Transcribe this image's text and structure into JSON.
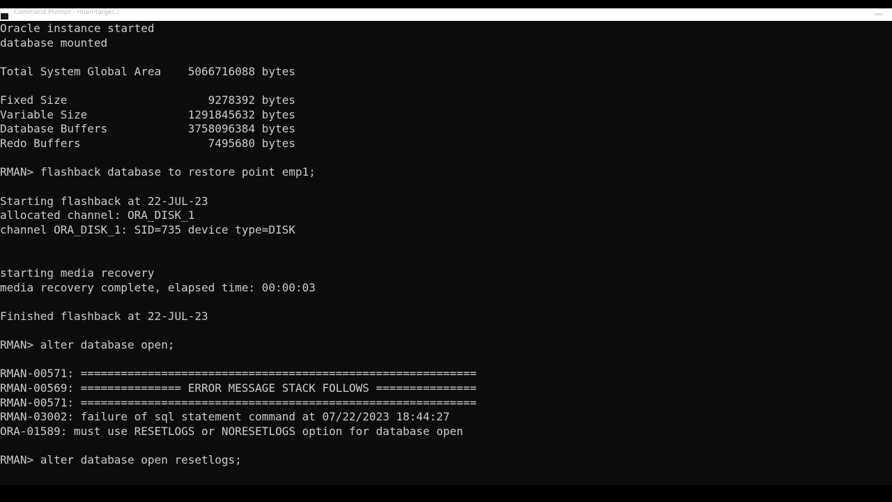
{
  "window": {
    "title": "Command Prompt - rman target /"
  },
  "console": {
    "lines": [
      "Oracle instance started",
      "database mounted",
      "",
      "Total System Global Area    5066716088 bytes",
      "",
      "Fixed Size                     9278392 bytes",
      "Variable Size               1291845632 bytes",
      "Database Buffers            3758096384 bytes",
      "Redo Buffers                   7495680 bytes",
      "",
      "RMAN> flashback database to restore point emp1;",
      "",
      "Starting flashback at 22-JUL-23",
      "allocated channel: ORA_DISK_1",
      "channel ORA_DISK_1: SID=735 device type=DISK",
      "",
      "",
      "starting media recovery",
      "media recovery complete, elapsed time: 00:00:03",
      "",
      "Finished flashback at 22-JUL-23",
      "",
      "RMAN> alter database open;",
      "",
      "RMAN-00571: ===========================================================",
      "RMAN-00569: =============== ERROR MESSAGE STACK FOLLOWS ===============",
      "RMAN-00571: ===========================================================",
      "RMAN-03002: failure of sql statement command at 07/22/2023 18:44:27",
      "ORA-01589: must use RESETLOGS or NORESETLOGS option for database open",
      "",
      "RMAN> alter database open resetlogs;",
      ""
    ]
  },
  "colors": {
    "background": "#0c0c0c",
    "text": "#cccccc",
    "titlebar": "#ffffff"
  }
}
